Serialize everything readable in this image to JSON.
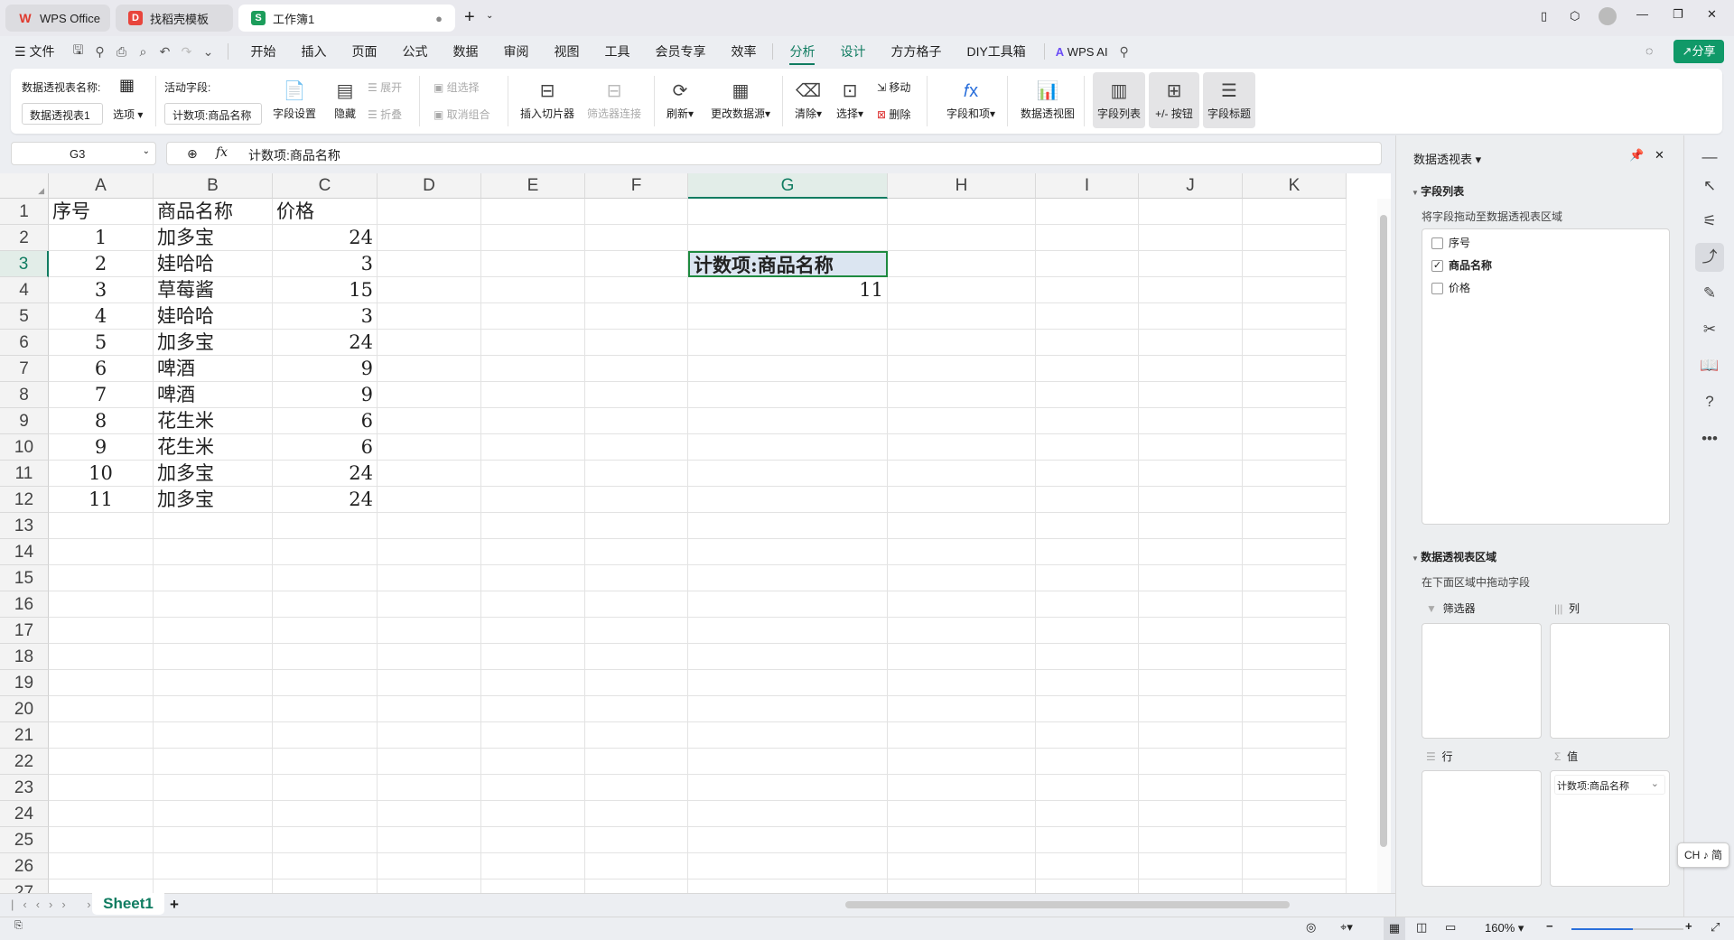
{
  "tabs": [
    {
      "label": "WPS Office",
      "icon": "W"
    },
    {
      "label": "找稻壳模板",
      "icon": "D"
    },
    {
      "label": "工作簿1",
      "icon": "S"
    }
  ],
  "menu": {
    "file": "文件",
    "items": [
      "开始",
      "插入",
      "页面",
      "公式",
      "数据",
      "审阅",
      "视图",
      "工具",
      "会员专享",
      "效率",
      "分析",
      "设计",
      "方方格子",
      "DIY工具箱"
    ],
    "wps_ai": "WPS AI",
    "share": "分享"
  },
  "ribbon": {
    "pt_name_label": "数据透视表名称:",
    "pt_name_value": "数据透视表1",
    "options": "选项",
    "active_field_label": "活动字段:",
    "active_field_value": "计数项:商品名称",
    "field_settings": "字段设置",
    "hide": "隐藏",
    "expand": "展开",
    "collapse": "折叠",
    "group_select": "组选择",
    "ungroup": "取消组合",
    "insert_slicer": "插入切片器",
    "filter_conn": "筛选器连接",
    "refresh": "刷新",
    "change_source": "更改数据源",
    "clear": "清除",
    "select": "选择",
    "move": "移动",
    "delete": "删除",
    "fields_items": "字段和项",
    "pivot_chart": "数据透视图",
    "field_list": "字段列表",
    "pm_buttons": "+/- 按钮",
    "field_headers": "字段标题"
  },
  "formula": {
    "cell_ref": "G3",
    "fx": "fx",
    "content": "计数项:商品名称"
  },
  "columns": [
    "A",
    "B",
    "C",
    "D",
    "E",
    "F",
    "G",
    "H",
    "I",
    "J",
    "K"
  ],
  "rows": [
    [
      "序号",
      "商品名称",
      "价格"
    ],
    [
      "1",
      "加多宝",
      "24"
    ],
    [
      "2",
      "娃哈哈",
      "3"
    ],
    [
      "3",
      "草莓酱",
      "15"
    ],
    [
      "4",
      "娃哈哈",
      "3"
    ],
    [
      "5",
      "加多宝",
      "24"
    ],
    [
      "6",
      "啤酒",
      "9"
    ],
    [
      "7",
      "啤酒",
      "9"
    ],
    [
      "8",
      "花生米",
      "6"
    ],
    [
      "9",
      "花生米",
      "6"
    ],
    [
      "10",
      "加多宝",
      "24"
    ],
    [
      "11",
      "加多宝",
      "24"
    ]
  ],
  "pivot": {
    "header": "计数项:商品名称",
    "value": "11"
  },
  "sheet": {
    "tab": "Sheet1",
    "add": "+"
  },
  "status": {
    "zoom": "160%",
    "zoom_fraction": 0.55
  },
  "panel": {
    "title": "数据透视表",
    "field_section": "字段列表",
    "field_hint": "将字段拖动至数据透视表区域",
    "fields": [
      {
        "label": "序号",
        "checked": false
      },
      {
        "label": "商品名称",
        "checked": true
      },
      {
        "label": "价格",
        "checked": false
      }
    ],
    "area_section": "数据透视表区域",
    "area_hint": "在下面区域中拖动字段",
    "filter": "筛选器",
    "column": "列",
    "row": "行",
    "value": "值",
    "value_item": "计数项:商品名称"
  },
  "ime": "CH ♪ 简"
}
